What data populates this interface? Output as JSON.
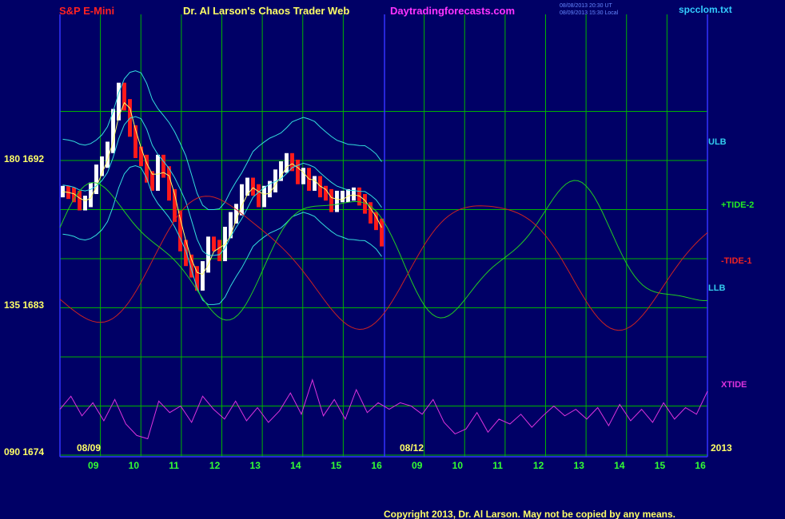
{
  "header": {
    "symbol": "S&P E-Mini",
    "title": "Dr. Al Larson's Chaos Trader Web",
    "site": "Daytradingforecasts.com",
    "stamp_ut": "08/08/2013 20:30 UT",
    "stamp_local": "08/09/2013 15:30 Local",
    "filename": "spcclom.txt"
  },
  "footer": {
    "copyright": "Copyright 2013, Dr. Al Larson. May not be copied by any means."
  },
  "colors": {
    "background": "#000066",
    "grid": "#00b400",
    "axis": "#3333ff",
    "price_up": "#ffffff",
    "price_down": "#ff1a1a",
    "avg_line": "#ffff66",
    "bands": "#33dddd",
    "tide_plus": "#22cc22",
    "tide_minus": "#cc2222",
    "xtide": "#dd33dd",
    "title": "#ffff66",
    "symbol": "#ff2222",
    "site": "#ff33ff",
    "filename": "#33ccff",
    "stamp": "#6688ff",
    "hours": "#33ff33",
    "dates": "#ffff66"
  },
  "chart_data": {
    "type": "line",
    "y_labels": [
      {
        "text": "180 1692",
        "y_price": 1692
      },
      {
        "text": "135 1683",
        "y_price": 1683
      },
      {
        "text": "090 1674",
        "y_price": 1674
      }
    ],
    "ylim": [
      1674,
      1692
    ],
    "date_labels": [
      "08/09",
      "08/12",
      "2013"
    ],
    "hour_ticks": [
      "09",
      "10",
      "11",
      "12",
      "13",
      "14",
      "15",
      "16",
      "09",
      "10",
      "11",
      "12",
      "13",
      "14",
      "15",
      "16"
    ],
    "today_boundary_index": 7.6,
    "legend": [
      {
        "name": "ULB",
        "color": "#33ccee"
      },
      {
        "name": "+TIDE-2",
        "color": "#22ee22"
      },
      {
        "name": "-TIDE-1",
        "color": "#ee2222"
      },
      {
        "name": "LLB",
        "color": "#33ccee"
      },
      {
        "name": "XTIDE",
        "color": "#dd33dd"
      }
    ],
    "price_close": [
      1690.1,
      1690.0,
      1689.8,
      1689.3,
      1689.5,
      1690.3,
      1691.4,
      1691.9,
      1692.8,
      1694.8,
      1696.4,
      1695.4,
      1693.8,
      1692.5,
      1692.0,
      1691.0,
      1690.5,
      1692.0,
      1691.3,
      1689.9,
      1688.6,
      1686.8,
      1685.9,
      1685.2,
      1684.4,
      1685.5,
      1687.0,
      1686.8,
      1686.2,
      1687.6,
      1688.5,
      1689.0,
      1690.2,
      1690.6,
      1690.2,
      1689.5,
      1690.1,
      1690.4,
      1691.1,
      1691.6,
      1692.1,
      1691.7,
      1690.9,
      1691.2,
      1690.5,
      1690.7,
      1690.1,
      1689.9,
      1689.2,
      1689.8,
      1689.8,
      1689.9,
      1690.0,
      1689.6,
      1689.1,
      1688.5,
      1688.1,
      1687.1
    ],
    "xtide": [
      1676.8,
      1677.6,
      1676.4,
      1677.2,
      1676.1,
      1677.4,
      1675.9,
      1675.2,
      1675.0,
      1677.3,
      1676.6,
      1677.0,
      1676.0,
      1677.6,
      1676.8,
      1676.2,
      1677.3,
      1676.1,
      1676.9,
      1676.0,
      1676.7,
      1677.8,
      1676.5,
      1678.6,
      1676.4,
      1677.4,
      1676.2,
      1678.0,
      1676.6,
      1677.2,
      1676.8,
      1677.2,
      1677.0,
      1676.5,
      1677.4,
      1676.0,
      1675.3,
      1675.6,
      1676.6,
      1675.4,
      1676.2,
      1675.9,
      1676.5,
      1675.7,
      1676.4,
      1677.0,
      1676.4,
      1676.8,
      1676.2,
      1676.9,
      1675.8,
      1677.1,
      1676.1,
      1676.8,
      1676.0,
      1677.2,
      1676.2,
      1676.9,
      1676.5,
      1677.9
    ]
  }
}
